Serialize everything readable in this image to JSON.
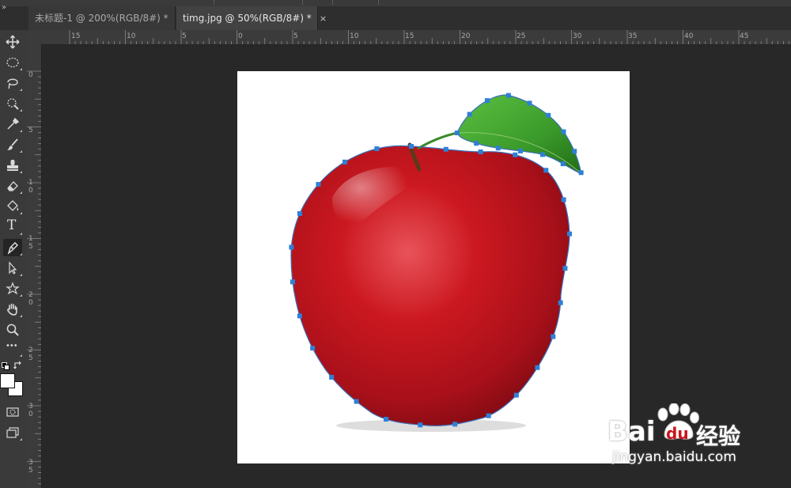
{
  "tabs": [
    {
      "label": "未标题-1 @ 200%(RGB/8#) *",
      "close": "×",
      "active": false
    },
    {
      "label": "timg.jpg @ 50%(RGB/8#) *",
      "close": "×",
      "active": true
    }
  ],
  "ruler_h": [
    "15",
    "10",
    "5",
    "0",
    "5",
    "10",
    "15",
    "20",
    "25",
    "30",
    "35",
    "40",
    "45"
  ],
  "ruler_v": [
    "0",
    "5",
    "1",
    "0",
    "1",
    "5",
    "2",
    "0",
    "2",
    "5",
    "3",
    "0",
    "3",
    "5"
  ],
  "toolbar": {
    "expand": "»",
    "type_tool": "T",
    "more": "•••",
    "tools": [
      "move-tool",
      "marquee-tool",
      "lasso-tool",
      "quick-select-tool",
      "eyedropper-tool",
      "brush-tool",
      "stamp-tool",
      "eraser-tool",
      "paint-bucket-tool",
      "type-tool",
      "pen-tool",
      "path-select-tool",
      "custom-shape-tool",
      "hand-tool",
      "zoom-tool",
      "more-tools",
      "swap-colors-icon",
      "color-swatches",
      "quick-mask-icon",
      "screen-mode-icon"
    ]
  },
  "watermark": {
    "brand_latin": "Bai",
    "brand_du": "du",
    "brand_cn": "经验",
    "url": "jingyan.baidu.com"
  },
  "colors": {
    "accent_path": "#2f80d6",
    "apple_red": "#c8141c",
    "leaf_green": "#3a9a2a",
    "watermark": "#ffffff"
  }
}
